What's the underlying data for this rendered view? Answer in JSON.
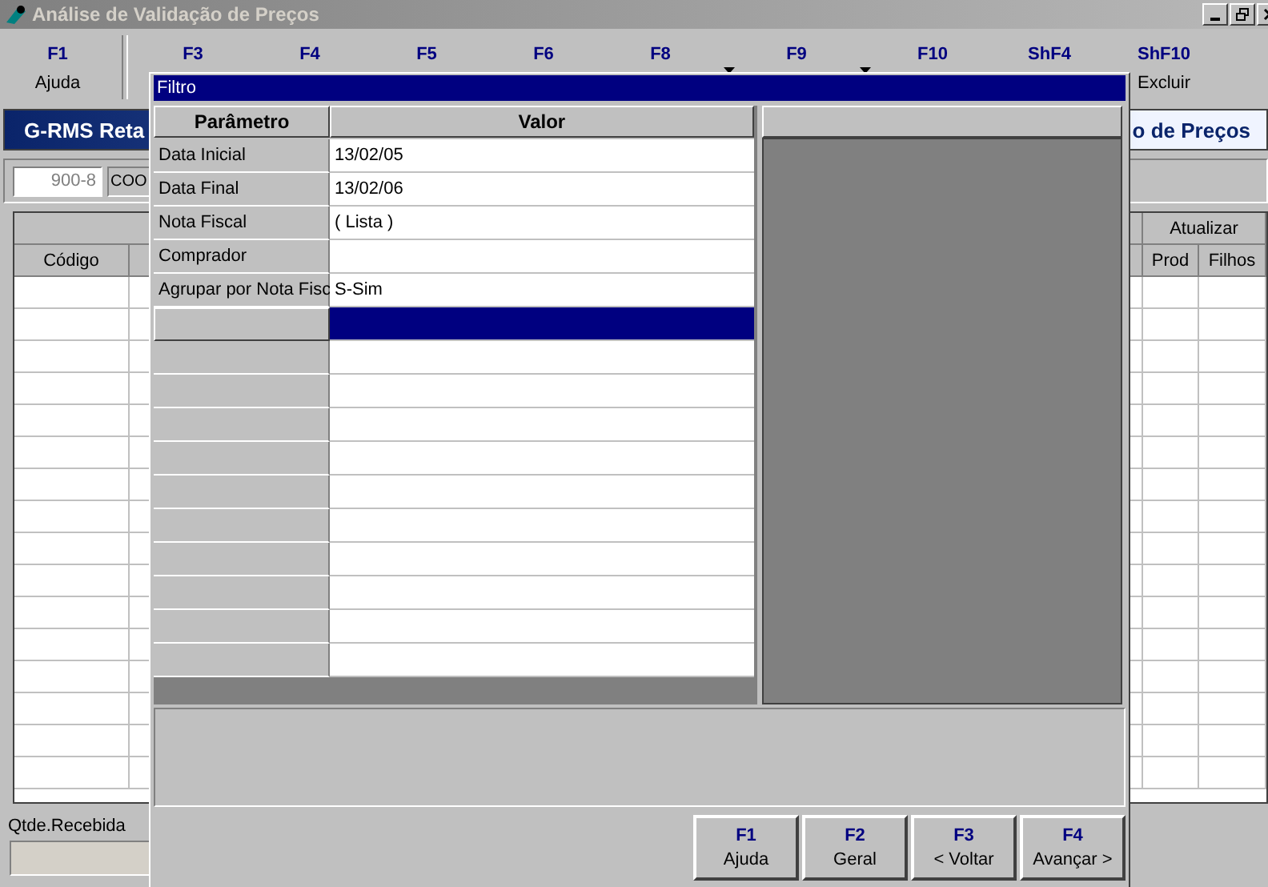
{
  "window": {
    "title": "Análise de Validação de Preços"
  },
  "toolbar": [
    {
      "kind": "tool",
      "key": "F1",
      "label": "Ajuda",
      "dropdown": false
    },
    {
      "kind": "separator"
    },
    {
      "kind": "tool",
      "key": "F3",
      "dropdown": false
    },
    {
      "kind": "tool",
      "key": "F4",
      "dropdown": false
    },
    {
      "kind": "tool",
      "key": "F5",
      "dropdown": false
    },
    {
      "kind": "tool",
      "key": "F6",
      "dropdown": false
    },
    {
      "kind": "tool",
      "key": "F8",
      "dropdown": true
    },
    {
      "kind": "tool",
      "key": "F9",
      "dropdown": true
    },
    {
      "kind": "tool",
      "key": "F10",
      "dropdown": false
    },
    {
      "kind": "tool",
      "key": "ShF4",
      "dropdown": false
    },
    {
      "kind": "tool",
      "key": "ShF10",
      "label": "Excluir",
      "dropdown": false
    }
  ],
  "banner": {
    "left": "G-RMS Reta",
    "right": "o de Preços"
  },
  "fields": [
    {
      "value": "900-8",
      "disabled": true
    },
    {
      "value": "COO",
      "disabled": false
    }
  ],
  "grid": {
    "header": "Atualizar",
    "columns": [
      "Código",
      "Prod",
      "Filhos"
    ]
  },
  "quantity": {
    "label": "Qtde.Recebida"
  },
  "dialog": {
    "title": "Filtro",
    "columns": [
      "Parâmetro",
      "Valor"
    ],
    "rows": [
      {
        "parameter": "Data Inicial",
        "value": "13/02/05",
        "selected": false
      },
      {
        "parameter": "Data Final",
        "value": "13/02/06",
        "selected": false
      },
      {
        "parameter": "Nota Fiscal",
        "value": "( Lista )",
        "selected": false
      },
      {
        "parameter": "Comprador",
        "selected": false
      },
      {
        "parameter": "Agrupar por Nota Fisc",
        "value": "S-Sim",
        "selected": false
      },
      {
        "selected": true
      }
    ],
    "buttons": [
      {
        "key": "F1",
        "label": "Ajuda"
      },
      {
        "key": "F2",
        "label": "Geral"
      },
      {
        "key": "F3",
        "label": "< Voltar"
      },
      {
        "key": "F4",
        "label": "Avançar >"
      }
    ]
  }
}
